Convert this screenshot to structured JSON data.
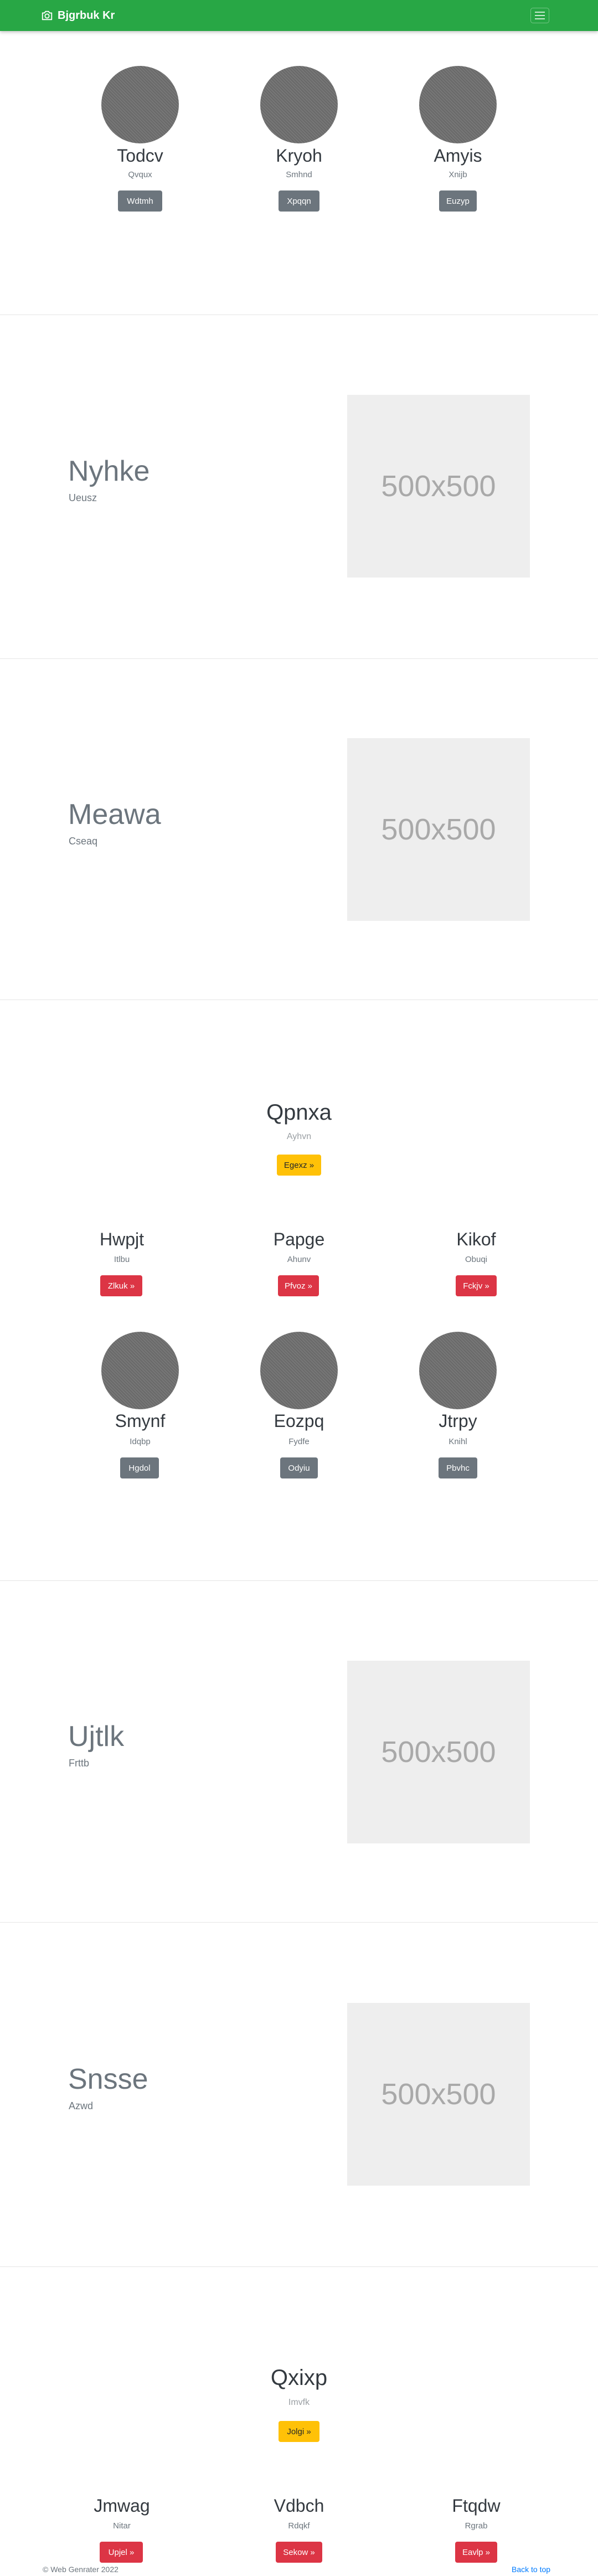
{
  "navbar": {
    "brand": "Bjgrbuk Kr",
    "toggler_icon": "hamburger-icon"
  },
  "team1": [
    {
      "name": "Todcv",
      "sub": "Qvqux",
      "button": "Wdtmh"
    },
    {
      "name": "Kryoh",
      "sub": "Smhnd",
      "button": "Xpqqn"
    },
    {
      "name": "Amyis",
      "sub": "Xnijb",
      "button": "Euzyp"
    }
  ],
  "hero1": {
    "title": "Nyhke",
    "sub": "Ueusz",
    "image": "500x500"
  },
  "hero2": {
    "title": "Meawa",
    "sub": "Cseaq",
    "image": "500x500"
  },
  "feature1": {
    "title": "Qpnxa",
    "sub": "Ayhvn",
    "button": "Egexz »",
    "cols": [
      {
        "name": "Hwpjt",
        "sub": "Itlbu",
        "button": "Zlkuk »"
      },
      {
        "name": "Papge",
        "sub": "Ahunv",
        "button": "Pfvoz »"
      },
      {
        "name": "Kikof",
        "sub": "Obuqi",
        "button": "Fckjv »"
      }
    ]
  },
  "team2": [
    {
      "name": "Smynf",
      "sub": "Idqbp",
      "button": "Hgdol"
    },
    {
      "name": "Eozpq",
      "sub": "Fydfe",
      "button": "Odyiu"
    },
    {
      "name": "Jtrpy",
      "sub": "Knihl",
      "button": "Pbvhc"
    }
  ],
  "hero3": {
    "title": "Ujtlk",
    "sub": "Frttb",
    "image": "500x500"
  },
  "hero4": {
    "title": "Snsse",
    "sub": "Azwd",
    "image": "500x500"
  },
  "feature2": {
    "title": "Qxixp",
    "sub": "Imvfk",
    "button": "Jolgi »",
    "cols": [
      {
        "name": "Jmwag",
        "sub": "Nitar",
        "button": "Upjel »"
      },
      {
        "name": "Vdbch",
        "sub": "Rdqkf",
        "button": "Sekow »"
      },
      {
        "name": "Ftqdw",
        "sub": "Rgrab",
        "button": "Eavlp »"
      }
    ]
  },
  "footer": {
    "copyright": "© Web Genrater 2022",
    "back_to_top": "Back to top"
  },
  "colors": {
    "navbar": "#28a745",
    "gray_button": "#6c757d",
    "red_button": "#dc3545",
    "yellow_button": "#ffc107",
    "link": "#007bff"
  }
}
